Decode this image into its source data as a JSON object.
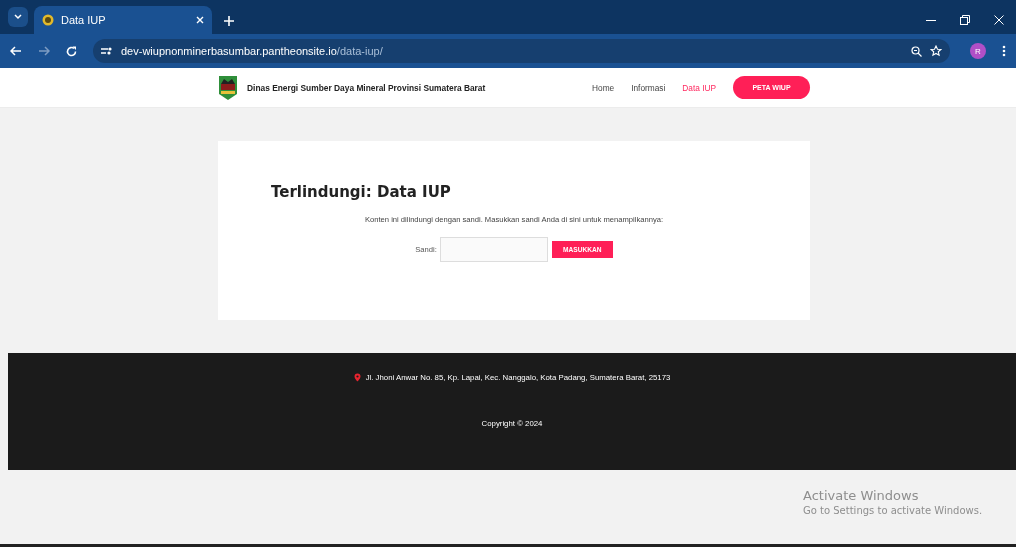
{
  "browser": {
    "tab_title": "Data IUP",
    "url_host": "dev-wiupnonminerbasumbar.pantheonsite.io",
    "url_path": "/data-iup/",
    "profile_initial": "R"
  },
  "header": {
    "site_title": "Dinas Energi Sumber Daya Mineral Provinsi Sumatera Barat",
    "nav": [
      {
        "label": "Home",
        "selected": false
      },
      {
        "label": "Informasi",
        "selected": false
      },
      {
        "label": "Data IUP",
        "selected": true
      }
    ],
    "cta": "PETA WIUP"
  },
  "protected": {
    "title": "Terlindungi: Data IUP",
    "message": "Konten ini dilindungi dengan sandi. Masukkan sandi Anda di sini untuk menampilkannya:",
    "field_label": "Sandi:",
    "submit": "MASUKKAN"
  },
  "footer": {
    "address": "Jl. Jhoni Anwar No. 85, Kp. Lapai, Kec. Nanggalo, Kota Padang, Sumatera Barat, 25173",
    "copyright": "Copyright © 2024"
  },
  "os_notice": {
    "title": "Activate Windows",
    "subtitle": "Go to Settings to activate Windows."
  }
}
